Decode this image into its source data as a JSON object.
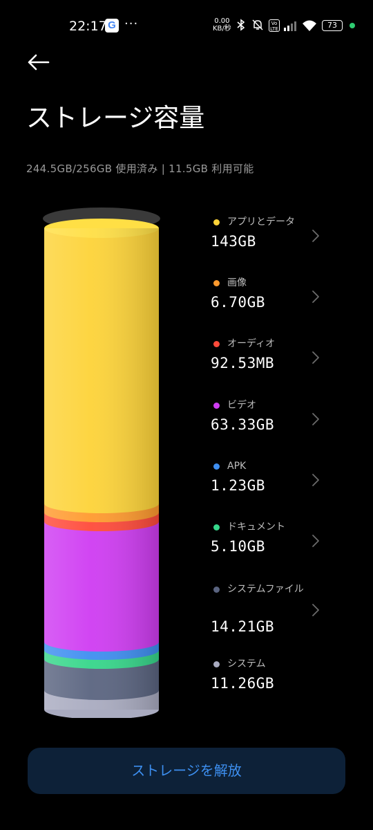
{
  "status_bar": {
    "time": "22:17",
    "google_letter": "G",
    "more": "···",
    "net_speed_value": "0.00",
    "net_speed_unit": "KB/秒",
    "volte": "Vo LTE",
    "battery": "73"
  },
  "header": {
    "title": "ストレージ容量",
    "summary": "244.5GB/256GB 使用済み | 11.5GB 利用可能"
  },
  "categories": [
    {
      "name": "アプリとデータ",
      "size": "143GB",
      "color": "#fdd338"
    },
    {
      "name": "画像",
      "size": "6.70GB",
      "color": "#ff9a2e"
    },
    {
      "name": "オーディオ",
      "size": "92.53MB",
      "color": "#ff4a3a"
    },
    {
      "name": "ビデオ",
      "size": "63.33GB",
      "color": "#cf3cf2"
    },
    {
      "name": "APK",
      "size": "1.23GB",
      "color": "#3e8ef0"
    },
    {
      "name": "ドキュメント",
      "size": "5.10GB",
      "color": "#36d68a"
    },
    {
      "name": "システムファイル",
      "size": "14.21GB",
      "color": "#5a6480"
    },
    {
      "name": "システム",
      "size": "11.26GB",
      "color": "#a9abc0"
    }
  ],
  "actions": {
    "free_storage": "ストレージを解放"
  }
}
